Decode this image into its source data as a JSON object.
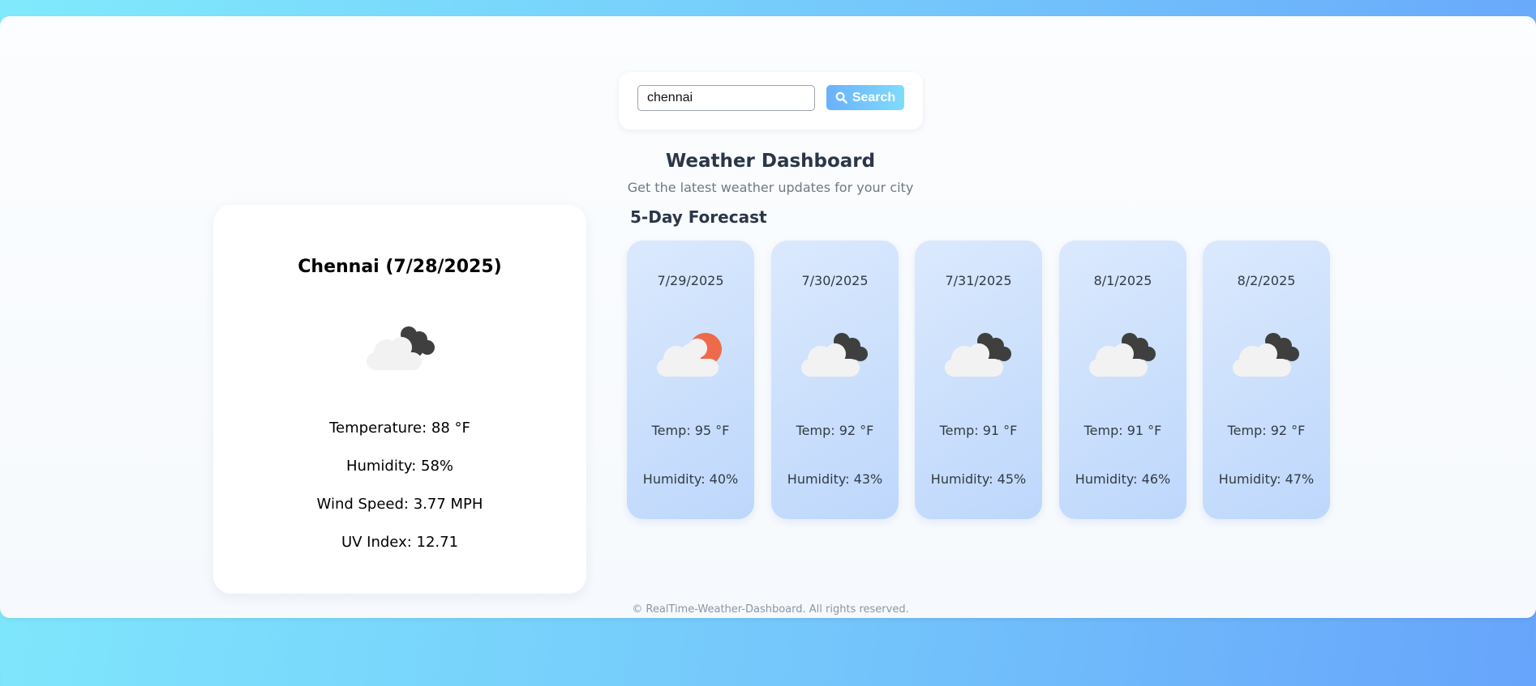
{
  "search": {
    "value": "chennai",
    "button_label": "Search"
  },
  "header": {
    "title": "Weather Dashboard",
    "subtitle": "Get the latest weather updates for your city"
  },
  "current": {
    "city_date": "Chennai (7/28/2025)",
    "icon": "cloudy-night-icon",
    "temperature": "Temperature: 88 °F",
    "humidity": "Humidity: 58%",
    "wind": "Wind Speed: 3.77 MPH",
    "uv": "UV Index: 12.71"
  },
  "forecast": {
    "heading": "5-Day Forecast",
    "days": [
      {
        "date": "7/29/2025",
        "icon": "partly-cloudy-sun-icon",
        "temp": "Temp: 95 °F",
        "humidity": "Humidity: 40%"
      },
      {
        "date": "7/30/2025",
        "icon": "cloudy-night-icon",
        "temp": "Temp: 92 °F",
        "humidity": "Humidity: 43%"
      },
      {
        "date": "7/31/2025",
        "icon": "cloudy-night-icon",
        "temp": "Temp: 91 °F",
        "humidity": "Humidity: 45%"
      },
      {
        "date": "8/1/2025",
        "icon": "cloudy-night-icon",
        "temp": "Temp: 91 °F",
        "humidity": "Humidity: 46%"
      },
      {
        "date": "8/2/2025",
        "icon": "cloudy-night-icon",
        "temp": "Temp: 92 °F",
        "humidity": "Humidity: 47%"
      }
    ]
  },
  "footer": {
    "text": "© RealTime-Weather-Dashboard. All rights reserved."
  },
  "colors": {
    "sun": "#ee6a4a",
    "dark_cloud": "#3f3f3f",
    "light_cloud": "#f2f2f2",
    "accent": "#6ab0fb"
  }
}
